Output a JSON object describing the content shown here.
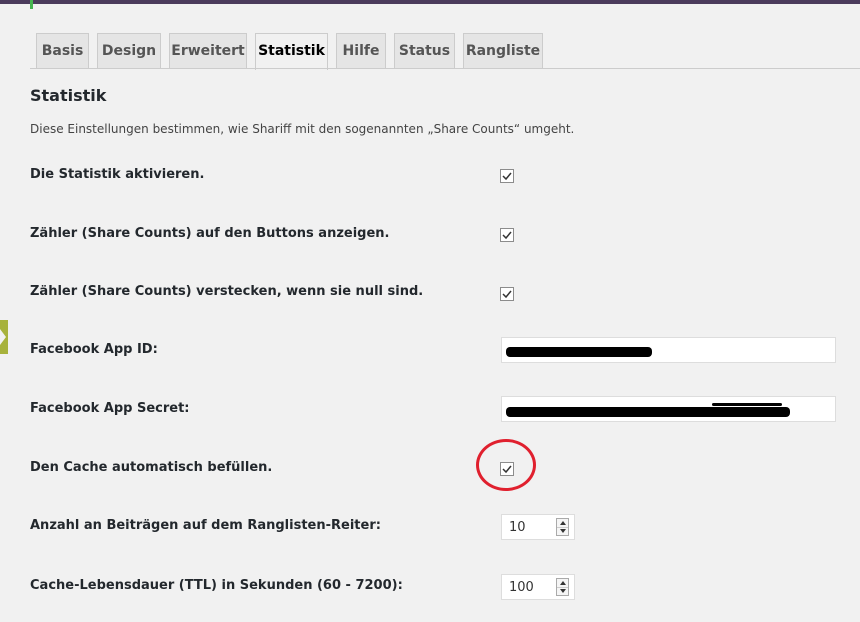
{
  "tabs": [
    {
      "label": "Basis"
    },
    {
      "label": "Design"
    },
    {
      "label": "Erweitert"
    },
    {
      "label": "Statistik",
      "active": true
    },
    {
      "label": "Hilfe"
    },
    {
      "label": "Status"
    },
    {
      "label": "Rangliste"
    }
  ],
  "section": {
    "title": "Statistik",
    "description": "Diese Einstellungen bestimmen, wie Shariff mit den sogenannten „Share Counts“ umgeht."
  },
  "settings": {
    "enable_stats": {
      "label": "Die Statistik aktivieren.",
      "checked": true
    },
    "show_counts": {
      "label": "Zähler (Share Counts) auf den Buttons anzeigen.",
      "checked": true
    },
    "hide_zero": {
      "label": "Zähler (Share Counts) verstecken, wenn sie null sind.",
      "checked": true
    },
    "fb_app_id": {
      "label": "Facebook App ID:"
    },
    "fb_app_secret": {
      "label": "Facebook App Secret:"
    },
    "auto_cache": {
      "label": "Den Cache automatisch befüllen.",
      "checked": true
    },
    "ranking_count": {
      "label": "Anzahl an Beiträgen auf dem Ranglisten-Reiter:",
      "value": "10"
    },
    "cache_ttl": {
      "label": "Cache-Lebensdauer (TTL) in Sekunden (60 - 7200):",
      "value": "100"
    }
  },
  "colors": {
    "annotation_circle": "#e0202e",
    "admin_bar": "#4b3b5c"
  }
}
